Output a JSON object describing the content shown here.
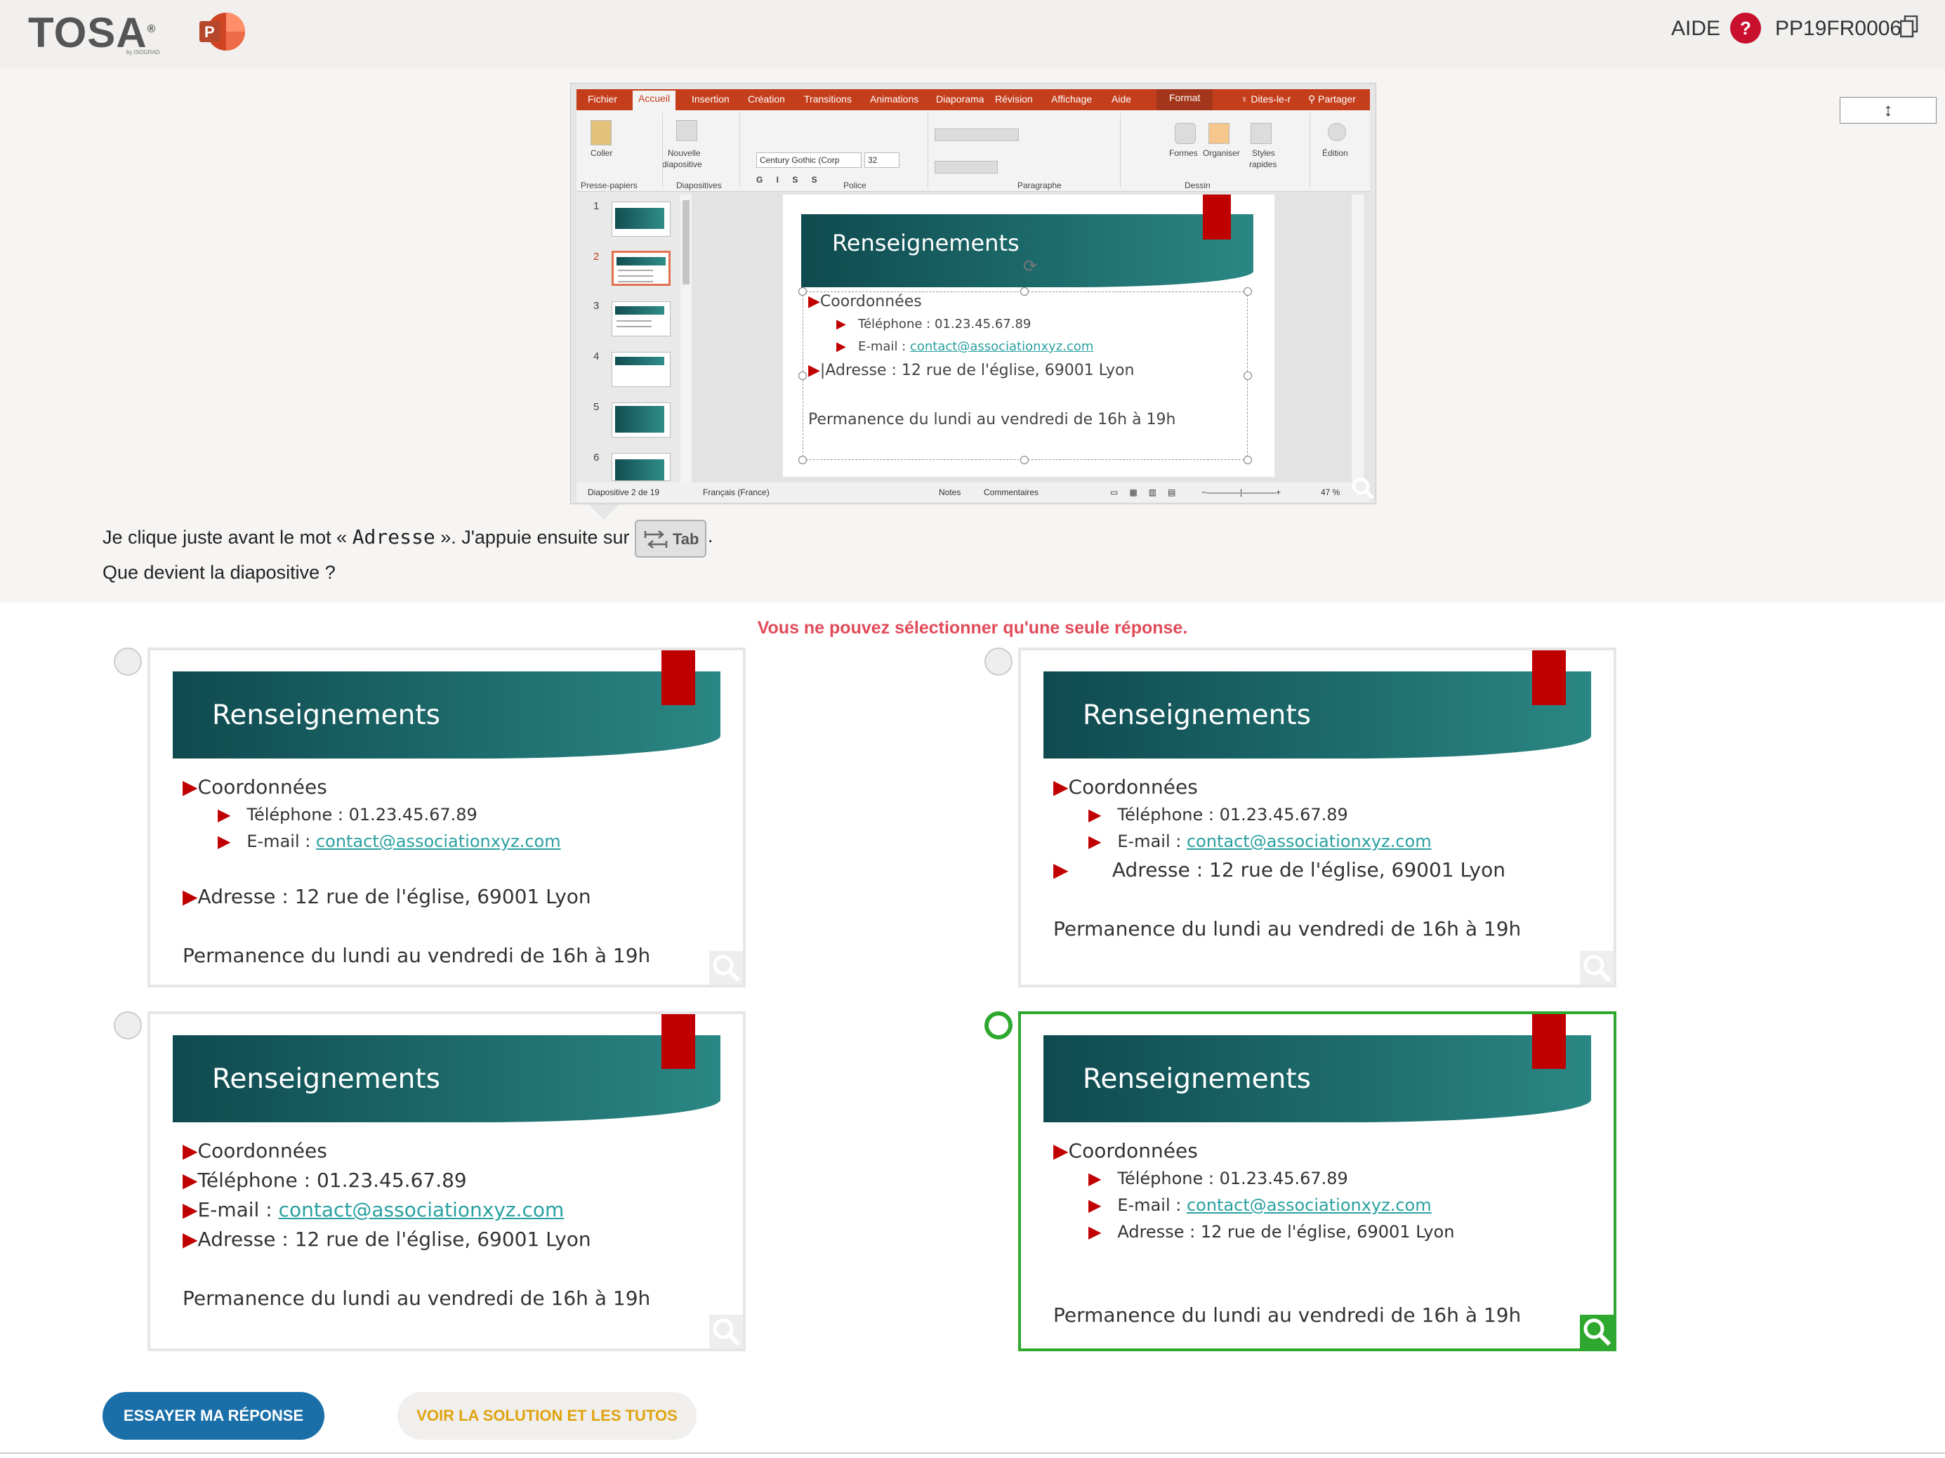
{
  "header": {
    "logo": "TOSA",
    "logo_registered": "®",
    "logo_sub": "by ISOGRAD",
    "app_icon": "powerpoint-icon",
    "aide_label": "AIDE",
    "help_glyph": "?",
    "question_code": "PP19FR0006"
  },
  "resize_glyph": "↕",
  "ppt": {
    "tabs": [
      "Fichier",
      "Accueil",
      "Insertion",
      "Création",
      "Transitions",
      "Animations",
      "Diaporama",
      "Révision",
      "Affichage",
      "Aide",
      "Format",
      "Dites-le-r",
      "Partager"
    ],
    "ribbon": {
      "coller": "Coller",
      "nouvelle": "Nouvelle",
      "diapositive": "diapositive",
      "font_name": "Century Gothic (Corp",
      "font_size": "32",
      "formes": "Formes",
      "organiser": "Organiser",
      "styles": "Styles",
      "rapides": "rapides",
      "edition": "Édition",
      "groups": [
        "Presse-papiers",
        "Diapositives",
        "Police",
        "Paragraphe",
        "Dessin"
      ]
    },
    "thumb_numbers": [
      "1",
      "2",
      "3",
      "4",
      "5",
      "6"
    ],
    "slide": {
      "title": "Renseignements",
      "coordonnees": "Coordonnées",
      "telephone": "Téléphone : 01.23.45.67.89",
      "email_label": "E-mail : ",
      "email_link": "contact@associationxyz.com",
      "adresse": "Adresse : 12 rue de l'église, 69001 Lyon",
      "permanence": "Permanence du lundi au vendredi de 16h à 19h"
    },
    "status": {
      "slide_count": "Diapositive 2 de 19",
      "language": "Français (France)",
      "notes": "Notes",
      "comments": "Commentaires",
      "zoom": "47 %"
    }
  },
  "question": {
    "line1_before": "Je clique juste avant le mot « ",
    "line1_word": "Adresse",
    "line1_after": " ». J'appuie ensuite sur ",
    "key_label": "Tab",
    "line1_end": ".",
    "line2": "Que devient la diapositive ?"
  },
  "warning": "Vous ne pouvez sélectionner qu'une seule réponse.",
  "options": [
    {
      "title": "Renseignements",
      "coordonnees": "Coordonnées",
      "telephone": "Téléphone : 01.23.45.67.89",
      "email_label": "E-mail : ",
      "email_link": "contact@associationxyz.com",
      "adresse": "Adresse : 12 rue de l'église, 69001 Lyon",
      "permanence": "Permanence du lundi au vendredi de 16h à 19h",
      "selected": false
    },
    {
      "title": "Renseignements",
      "coordonnees": "Coordonnées",
      "telephone": "Téléphone : 01.23.45.67.89",
      "email_label": "E-mail : ",
      "email_link": "contact@associationxyz.com",
      "adresse": "Adresse : 12 rue de l'église, 69001 Lyon",
      "permanence": "Permanence du lundi au vendredi de 16h à 19h",
      "selected": false
    },
    {
      "title": "Renseignements",
      "coordonnees": "Coordonnées",
      "telephone": "Téléphone : 01.23.45.67.89",
      "email_label": "E-mail : ",
      "email_link": "contact@associationxyz.com",
      "adresse": "Adresse : 12 rue de l'église, 69001 Lyon",
      "permanence": "Permanence du lundi au vendredi de 16h à 19h",
      "selected": false
    },
    {
      "title": "Renseignements",
      "coordonnees": "Coordonnées",
      "telephone": "Téléphone : 01.23.45.67.89",
      "email_label": "E-mail : ",
      "email_link": "contact@associationxyz.com",
      "adresse": "Adresse : 12 rue de l'église, 69001 Lyon",
      "permanence": "Permanence du lundi au vendredi de 16h à 19h",
      "selected": true
    }
  ],
  "buttons": {
    "submit": "ESSAYER MA RÉPONSE",
    "solution": "VOIR LA SOLUTION ET LES TUTOS"
  },
  "colors": {
    "accent_red": "#c8102e",
    "ppt_orange": "#c43e1c",
    "teal": "#1f6f70",
    "selected_green": "#2ea82e",
    "primary_blue": "#1a6fa8",
    "secondary_text": "#e0a310",
    "warning_red": "#e14b5a"
  }
}
